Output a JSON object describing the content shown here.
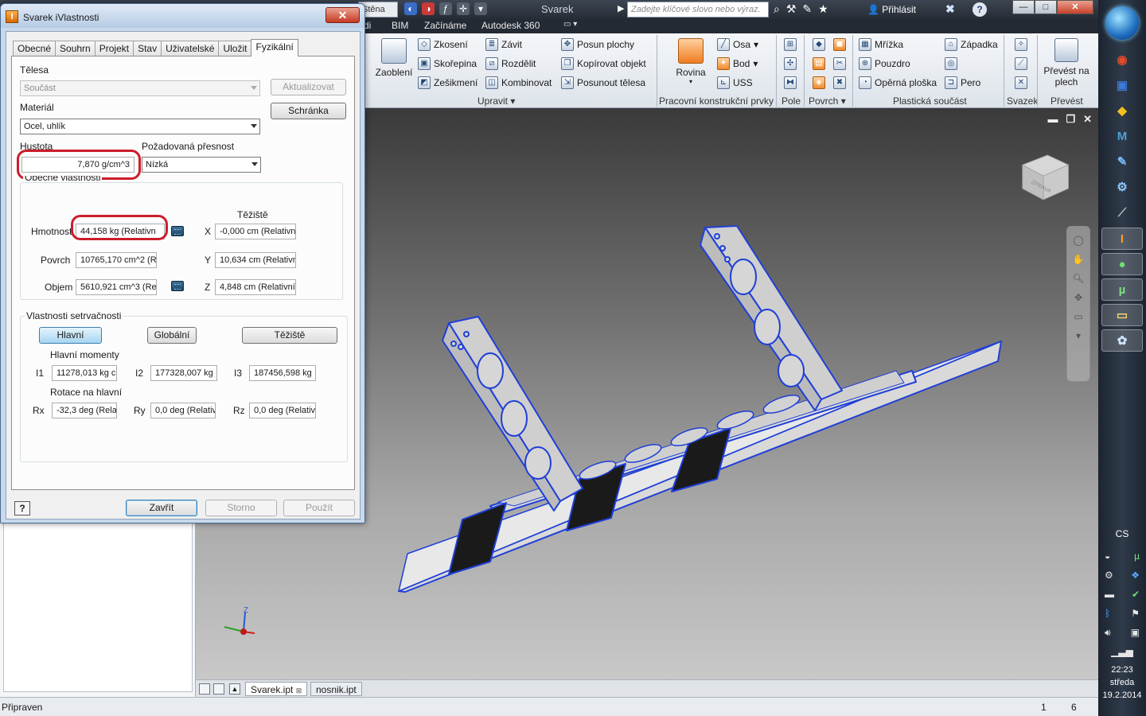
{
  "app": {
    "doc_title": "Svarek",
    "qat_field": "Stěna",
    "search_placeholder": "Zadejte klíčové slovo nebo výraz.",
    "login_label": "Přihlásit",
    "help_label": "?"
  },
  "window_buttons": {
    "minimize": "—",
    "maximize": "□",
    "close": "✕"
  },
  "ribbon_tabs": [
    "di",
    "BIM",
    "Začínáme",
    "Autodesk 360"
  ],
  "ribbon": {
    "zaobleni": "Zaoblení",
    "modify": {
      "items": [
        "Zkosení",
        "Skořepina",
        "Zešikmení",
        "Závit",
        "Rozdělit",
        "Kombinovat",
        "Posun plochy",
        "Kopírovat objekt",
        "Posunout tělesa"
      ],
      "label": "Upravit"
    },
    "work_features": {
      "rovina": "Rovina",
      "items": [
        "Osa",
        "Bod",
        "USS"
      ],
      "label": "Pracovní konstrukční prvky"
    },
    "pole_label": "Pole",
    "povrch_label": "Povrch",
    "plastic": {
      "items": [
        "Mřížka",
        "Pouzdro",
        "Opěrná ploška",
        "Západka",
        "Pero"
      ],
      "label": "Plastická součást"
    },
    "svazek_label": "Svazek",
    "convert": {
      "button": "Převést na plech",
      "label": "Převést"
    }
  },
  "dialog": {
    "title": "Svarek iVlastnosti",
    "close_label": "✕",
    "tabs": [
      "Obecné",
      "Souhrn",
      "Projekt",
      "Stav",
      "Uživatelské",
      "Uložit",
      "Fyzikální"
    ],
    "active_tab": "Fyzikální",
    "telesa_label": "Tělesa",
    "telesa_value": "Součást",
    "update_button": "Aktualizovat",
    "clipboard_button": "Schránka",
    "material_label": "Materiál",
    "material_value": "Ocel, uhlík",
    "density_label": "Hustota",
    "density_value": "7,870 g/cm^3",
    "accuracy_label": "Požadovaná přesnost",
    "accuracy_value": "Nízká",
    "general_group": "Obecné vlastnosti",
    "cog_label": "Těžiště",
    "mass_label": "Hmotnost",
    "mass_value": "44,158 kg (Relativn",
    "area_label": "Povrch",
    "area_value": "10765,170 cm^2 (R",
    "volume_label": "Objem",
    "volume_value": "5610,921 cm^3 (Re",
    "cog_x_label": "X",
    "cog_x": "-0,000 cm (Relativn",
    "cog_y_label": "Y",
    "cog_y": "10,634 cm (Relativn",
    "cog_z_label": "Z",
    "cog_z": "4,848 cm (Relativní",
    "inertia_group": "Vlastnosti setrvačnosti",
    "btn_main": "Hlavní",
    "btn_global": "Globální",
    "btn_cog": "Těžiště",
    "principal_moments": "Hlavní momenty",
    "i1_label": "I1",
    "i1": "11278,013 kg c",
    "i2_label": "I2",
    "i2": "177328,007 kg",
    "i3_label": "I3",
    "i3": "187456,598 kg",
    "rotation_label": "Rotace na hlavní",
    "rx_label": "Rx",
    "rx": "-32,3 deg (Rela",
    "ry_label": "Ry",
    "ry": "0,0 deg (Relativ",
    "rz_label": "Rz",
    "rz": "0,0 deg (Relativ",
    "help": "?",
    "btn_close": "Zavřít",
    "btn_cancel": "Storno",
    "btn_apply": "Použít"
  },
  "viewcube_label": "ZPRAVA",
  "triad": {
    "z": "Z"
  },
  "doc_tabs": [
    "Svarek.ipt",
    "nosnik.ipt"
  ],
  "status": {
    "text": "Připraven",
    "num1": "1",
    "num2": "6"
  },
  "taskbar": {
    "lang": "CS",
    "time": "22:23",
    "day": "středa",
    "date": "19.2.2014"
  },
  "colors": {
    "highlight_red": "#cc1d2b",
    "model_edge_blue": "#1f3fd6",
    "viewport_top": "#3a3a3a",
    "viewport_bottom": "#c8c8c8"
  }
}
